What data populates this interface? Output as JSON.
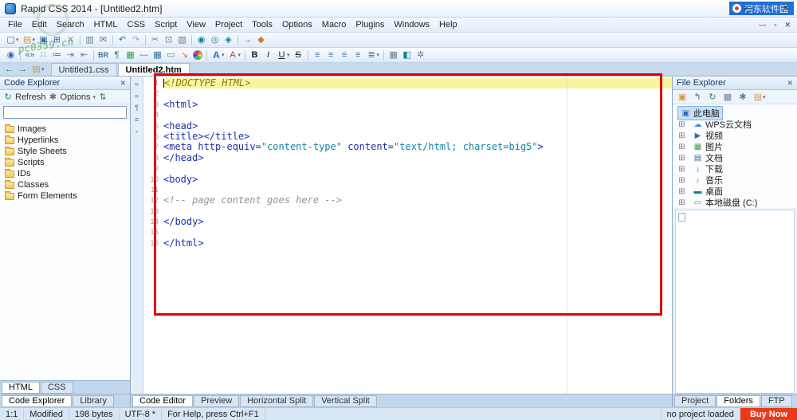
{
  "window": {
    "title": "Rapid CSS 2014 - [Untitled2.htm]",
    "minimize_glyph": "—",
    "maximize_glyph": "□",
    "close_glyph": "✕",
    "mdi_minimize": "—",
    "mdi_restore": "▫",
    "mdi_close": "✕"
  },
  "watermark": {
    "corner_text": "河东软件园",
    "stamp_site": "pc0359.cn"
  },
  "menu": {
    "items": [
      "File",
      "Edit",
      "Search",
      "HTML",
      "CSS",
      "Script",
      "View",
      "Project",
      "Tools",
      "Options",
      "Macro",
      "Plugins",
      "Windows",
      "Help"
    ]
  },
  "toolbar1": [
    {
      "name": "new-file-icon",
      "glyph": "▢",
      "color": "#3a6ea5",
      "dd": true
    },
    {
      "name": "open-file-icon",
      "glyph": "▤",
      "color": "#d79b3a",
      "dd": true
    },
    {
      "name": "save-icon",
      "glyph": "▣",
      "color": "#3a6ea5"
    },
    {
      "name": "save-all-icon",
      "glyph": "⊞",
      "color": "#3a6ea5"
    },
    {
      "name": "close-document-icon",
      "glyph": "✕",
      "color": "#8a99ab"
    },
    {
      "sep": true
    },
    {
      "name": "print-icon",
      "glyph": "▥",
      "color": "#6b7c8f"
    },
    {
      "name": "email-icon",
      "glyph": "✉",
      "color": "#6b7c8f"
    },
    {
      "sep": true
    },
    {
      "name": "undo-icon",
      "glyph": "↶",
      "color": "#2f66c4"
    },
    {
      "name": "redo-icon",
      "glyph": "↷",
      "color": "#9aa7b5"
    },
    {
      "sep": true
    },
    {
      "name": "cut-icon",
      "glyph": "✂",
      "color": "#6b7c8f"
    },
    {
      "name": "copy-icon",
      "glyph": "⊡",
      "color": "#6b7c8f"
    },
    {
      "name": "paste-icon",
      "glyph": "▧",
      "color": "#6b7c8f"
    },
    {
      "sep": true
    },
    {
      "name": "find-icon",
      "glyph": "◉",
      "color": "#167d9e"
    },
    {
      "name": "find-next-icon",
      "glyph": "◎",
      "color": "#167d9e"
    },
    {
      "name": "replace-icon",
      "glyph": "◈",
      "color": "#167d9e"
    },
    {
      "sep": true
    },
    {
      "name": "goto-line-icon",
      "glyph": "→",
      "color": "#1f8a4c"
    },
    {
      "name": "bookmark-icon",
      "glyph": "◆",
      "color": "#d7762a"
    }
  ],
  "toolbar2": [
    {
      "name": "browser-preview-icon",
      "glyph": "◉",
      "color": "#2f66c4"
    },
    {
      "sep": true
    },
    {
      "name": "tag-insert-icon",
      "glyph": "«»",
      "color": "#3a6ea5"
    },
    {
      "name": "bullet-list-icon",
      "glyph": "∷",
      "color": "#2f66c4"
    },
    {
      "name": "numbered-list-icon",
      "glyph": "≔",
      "color": "#2f66c4"
    },
    {
      "name": "indent-icon",
      "glyph": "⇥",
      "color": "#6b7c8f"
    },
    {
      "name": "outdent-icon",
      "glyph": "⇤",
      "color": "#6b7c8f"
    },
    {
      "sep": true
    },
    {
      "name": "line-break-button",
      "text": "BR",
      "cls": "txt"
    },
    {
      "name": "anchor-icon",
      "glyph": "¶",
      "color": "#167d9e"
    },
    {
      "name": "image-icon",
      "glyph": "▦",
      "color": "#3f9e57"
    },
    {
      "name": "horizontal-rule-icon",
      "glyph": "—",
      "color": "#6b7c8f"
    },
    {
      "name": "table-icon",
      "glyph": "▦",
      "color": "#3a6ea5"
    },
    {
      "name": "form-icon",
      "glyph": "▭",
      "color": "#6b7c8f"
    },
    {
      "name": "pointer-icon",
      "glyph": "↘",
      "color": "#d7762a"
    },
    {
      "name": "color-picker-icon",
      "special": "colorwheel"
    },
    {
      "sep": true
    },
    {
      "name": "font-size-icon",
      "glyph": "A",
      "cls": "bigA",
      "color": "#3a6ea5",
      "dd": true
    },
    {
      "name": "font-color-icon",
      "glyph": "A",
      "color": "#c23b3b",
      "dd": true
    },
    {
      "sep": true
    },
    {
      "name": "bold-button",
      "text": "B",
      "cls": "b"
    },
    {
      "name": "italic-button",
      "text": "I",
      "cls": "i"
    },
    {
      "name": "underline-button",
      "text": "U",
      "cls": "u",
      "dd": true
    },
    {
      "name": "strike-button",
      "text": "S",
      "cls": "s"
    },
    {
      "sep": true
    },
    {
      "name": "align-left-icon",
      "glyph": "≡",
      "color": "#3a6ea5"
    },
    {
      "name": "align-center-icon",
      "glyph": "≡",
      "color": "#3a6ea5"
    },
    {
      "name": "align-right-icon",
      "glyph": "≡",
      "color": "#3a6ea5"
    },
    {
      "name": "align-justify-icon",
      "glyph": "≡",
      "color": "#3a6ea5"
    },
    {
      "name": "line-spacing-icon",
      "glyph": "≣",
      "color": "#3a6ea5",
      "dd": true
    },
    {
      "sep": true
    },
    {
      "name": "table-grid-icon",
      "glyph": "▦",
      "color": "#6b7c8f"
    },
    {
      "name": "highlight-icon",
      "glyph": "◧",
      "color": "#167d9e"
    },
    {
      "name": "magic-icon",
      "glyph": "✲",
      "color": "#6b7c8f"
    }
  ],
  "nav_row": {
    "icons": [
      {
        "name": "back-icon",
        "glyph": "←",
        "color": "#1f8a4c"
      },
      {
        "name": "forward-icon",
        "glyph": "→",
        "color": "#1f8a4c"
      },
      {
        "name": "recent-files-icon",
        "glyph": "▤",
        "color": "#d79b3a",
        "dd": true
      }
    ]
  },
  "side_strip": [
    {
      "name": "fold-collapse-icon",
      "glyph": "«",
      "color": "#4a7ab5"
    },
    {
      "name": "fold-expand-icon",
      "glyph": "»",
      "color": "#4a7ab5"
    },
    {
      "name": "pilcrow-icon",
      "glyph": "¶",
      "color": "#6e7f91"
    },
    {
      "name": "wrap-icon",
      "glyph": "≡",
      "color": "#6e7f91"
    },
    {
      "name": "hint-icon",
      "glyph": "▪",
      "color": "#e0a020"
    }
  ],
  "document_tabs": [
    {
      "label": "Untitled1.css",
      "active": false
    },
    {
      "label": "Untitled2.htm",
      "active": true
    }
  ],
  "code_explorer": {
    "title": "Code Explorer",
    "close_glyph": "✕",
    "refresh_label": "Refresh",
    "options_label": "Options",
    "filter_value": "",
    "tree": [
      "Images",
      "Hyperlinks",
      "Style Sheets",
      "Scripts",
      "IDs",
      "Classes",
      "Form Elements"
    ],
    "type_tabs": [
      {
        "label": "HTML",
        "active": true
      },
      {
        "label": "CSS",
        "active": false
      }
    ],
    "dock_tabs": [
      {
        "label": "Code Explorer",
        "active": true
      },
      {
        "label": "Library",
        "active": false
      }
    ]
  },
  "editor": {
    "lines": [
      {
        "n": "1",
        "hl": true,
        "seg": [
          [
            "doctype",
            "<!DOCTYPE HTML>"
          ]
        ]
      },
      {
        "n": "2",
        "seg": []
      },
      {
        "n": "3",
        "seg": [
          [
            "tag",
            "<html>"
          ]
        ]
      },
      {
        "n": "4",
        "seg": []
      },
      {
        "n": "5",
        "seg": [
          [
            "tag",
            "<head>"
          ]
        ]
      },
      {
        "n": "6",
        "seg": [
          [
            "tag",
            "<title></title>"
          ]
        ]
      },
      {
        "n": "7",
        "seg": [
          [
            "tag",
            "<meta http-equiv="
          ],
          [
            "val",
            "\"content-type\""
          ],
          [
            "tag",
            " content="
          ],
          [
            "val",
            "\"text/html; charset=big5\""
          ],
          [
            "tag",
            ">"
          ]
        ]
      },
      {
        "n": "8",
        "seg": [
          [
            "tag",
            "</head>"
          ]
        ]
      },
      {
        "n": "9",
        "seg": []
      },
      {
        "n": "10",
        "seg": [
          [
            "tag",
            "<body>"
          ]
        ]
      },
      {
        "n": "11",
        "seg": []
      },
      {
        "n": "12",
        "seg": [
          [
            "comment",
            "<!-- page content goes here -->"
          ]
        ]
      },
      {
        "n": "13",
        "seg": []
      },
      {
        "n": "14",
        "seg": [
          [
            "tag",
            "</body>"
          ]
        ]
      },
      {
        "n": "15",
        "seg": []
      },
      {
        "n": "16",
        "seg": [
          [
            "tag",
            "</html>"
          ]
        ]
      }
    ]
  },
  "editor_tabs": [
    {
      "label": "Code Editor",
      "active": true
    },
    {
      "label": "Preview",
      "active": false
    },
    {
      "label": "Horizontal Split",
      "active": false
    },
    {
      "label": "Vertical Split",
      "active": false
    }
  ],
  "file_explorer": {
    "title": "File Explorer",
    "close_glyph": "✕",
    "toolbar": [
      {
        "name": "new-folder-icon",
        "glyph": "▣",
        "color": "#d79b3a"
      },
      {
        "name": "go-up-icon",
        "glyph": "↰",
        "color": "#3a6ea5"
      },
      {
        "name": "refresh-icon",
        "glyph": "↻",
        "color": "#1f8a4c"
      },
      {
        "name": "view-mode-icon",
        "glyph": "▦",
        "color": "#6b7c8f"
      },
      {
        "name": "settings-icon",
        "glyph": "✱",
        "color": "#6b7c8f"
      },
      {
        "name": "folder-dropdown-icon",
        "glyph": "▤",
        "color": "#d79b3a",
        "dd": true
      }
    ],
    "tree": [
      {
        "label": "此电脑",
        "icon": "computer",
        "selected": true
      },
      {
        "label": "WPS云文档",
        "icon": "cloud",
        "expander": "⊞"
      },
      {
        "label": "视频",
        "icon": "video",
        "expander": "⊞"
      },
      {
        "label": "图片",
        "icon": "picture",
        "expander": "⊞"
      },
      {
        "label": "文档",
        "icon": "document",
        "expander": "⊞"
      },
      {
        "label": "下载",
        "icon": "download",
        "expander": "⊞"
      },
      {
        "label": "音乐",
        "icon": "music",
        "expander": "⊞"
      },
      {
        "label": "桌面",
        "icon": "desktop",
        "expander": "⊞"
      },
      {
        "label": "本地磁盘 (C:)",
        "icon": "disk",
        "expander": "⊞"
      }
    ],
    "dock_tabs": [
      {
        "label": "Project",
        "active": false
      },
      {
        "label": "Folders",
        "active": true
      },
      {
        "label": "FTP",
        "active": false
      }
    ]
  },
  "status_bar": {
    "cursor": "1:1",
    "modified": "Modified",
    "bytes": "198 bytes",
    "encoding": "UTF-8 *",
    "help": "For Help, press Ctrl+F1",
    "project": "no project loaded",
    "buy_now": "Buy Now"
  }
}
